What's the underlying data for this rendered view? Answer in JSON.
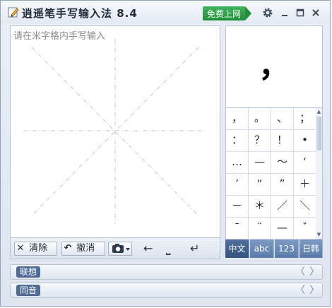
{
  "window": {
    "title": "逍遥笔手写输入法 8.4",
    "online_button": "免费上网",
    "settings_icon": "gear-icon",
    "minimize_icon": "minimize-icon",
    "maximize_icon": "maximize-icon",
    "close_icon": "close-icon"
  },
  "writing_area": {
    "placeholder": "请在米字格内手写输入"
  },
  "toolbar": {
    "clear_label": "清除",
    "undo_label": "撤消",
    "backspace_glyph": "←",
    "space_glyph": "⎵",
    "enter_glyph": "↵"
  },
  "preview": {
    "character": "，"
  },
  "candidates": [
    [
      "，",
      "。",
      "、",
      "；"
    ],
    [
      "：",
      "？",
      "！",
      "•"
    ],
    [
      "…",
      "—",
      "～",
      "‘"
    ],
    [
      "’",
      "“",
      "”",
      "＋"
    ],
    [
      "－",
      "＊",
      "／",
      "＼"
    ],
    [
      "ˉ",
      "¨",
      "—",
      "ˇ"
    ]
  ],
  "tabs": [
    {
      "label": "中文",
      "active": true
    },
    {
      "label": "abc",
      "active": false
    },
    {
      "label": "123",
      "active": false
    },
    {
      "label": "日韩",
      "active": false
    }
  ],
  "sections": {
    "association_label": "联想",
    "homophone_label": "同音",
    "prev_glyph": "〈",
    "next_glyph": "〉"
  }
}
